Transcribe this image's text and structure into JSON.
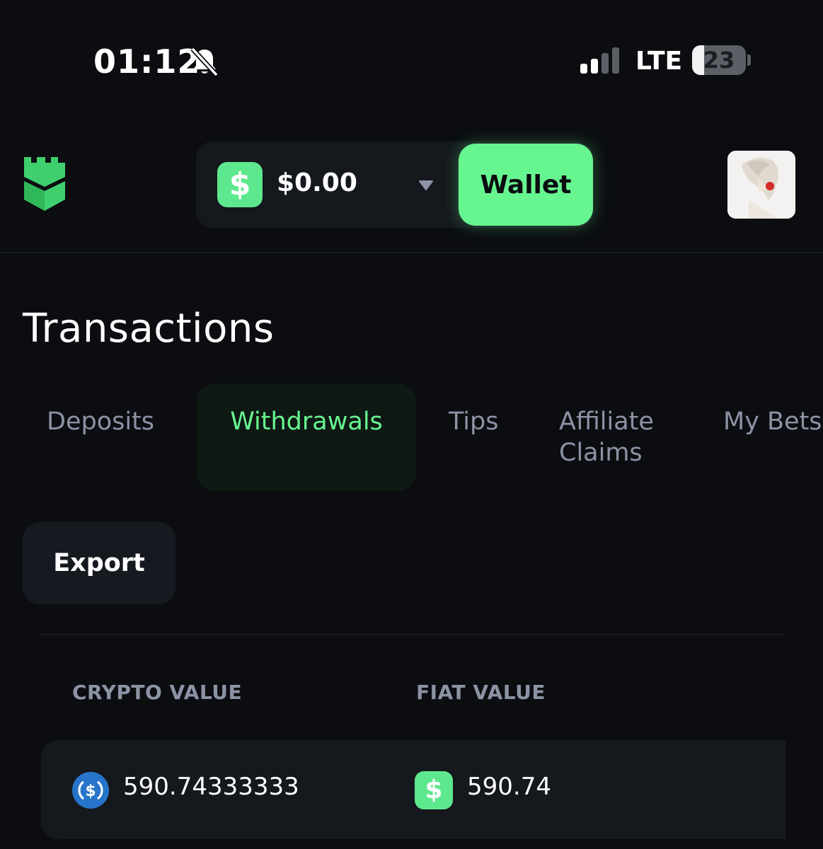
{
  "status_bar": {
    "time": "01:12",
    "network": "LTE",
    "battery": "23",
    "battery_level_percent": 23
  },
  "header": {
    "balance": "$0.00",
    "currency_symbol": "$",
    "wallet_label": "Wallet"
  },
  "page": {
    "title": "Transactions"
  },
  "tabs": [
    {
      "label": "Deposits"
    },
    {
      "label": "Withdrawals"
    },
    {
      "label": "Tips"
    },
    {
      "label": "Affiliate Claims"
    },
    {
      "label": "My Bets"
    }
  ],
  "active_tab": "Withdrawals",
  "actions": {
    "export_label": "Export"
  },
  "table": {
    "columns": [
      "CRYPTO VALUE",
      "FIAT VALUE"
    ],
    "rows": [
      {
        "crypto_value": "590.74333333",
        "fiat_symbol": "$",
        "fiat_value": "590.74"
      }
    ]
  },
  "colors": {
    "accent": "#67f590",
    "background": "#0b0d11",
    "muted_text": "#8b93a4",
    "usdc_blue": "#2775ca"
  },
  "icons": {
    "mute": "bell-slash-icon",
    "logo": "castle-tower-logo",
    "crypto": "usdc-coin-icon",
    "fiat": "dollar-icon",
    "caret": "caret-down-icon"
  }
}
